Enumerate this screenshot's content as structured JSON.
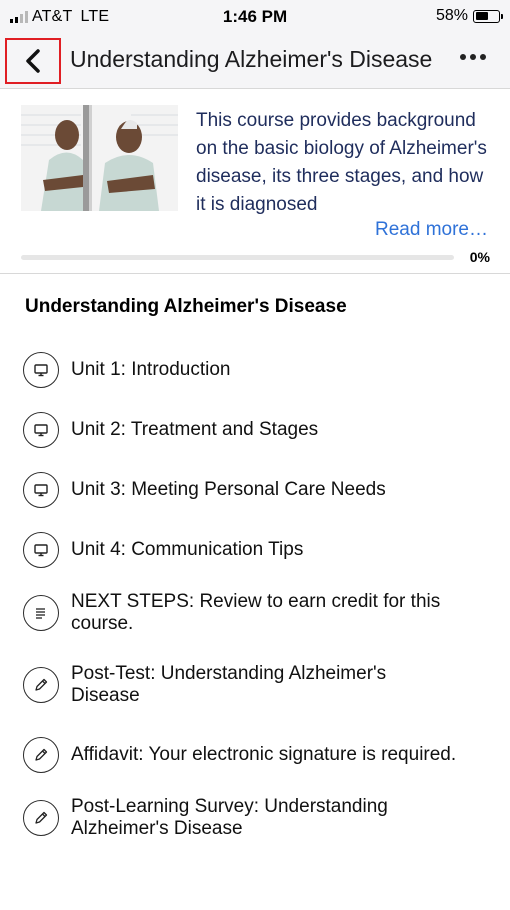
{
  "status_bar": {
    "carrier": "AT&T",
    "network": "LTE",
    "time": "1:46 PM",
    "battery": "58%",
    "battery_level": 0.58
  },
  "nav": {
    "title": "Understanding Alzheimer's Disease",
    "back_icon": "chevron-left-icon",
    "more_icon": "more-horizontal-icon"
  },
  "course": {
    "description": "This course provides background on the basic biology of Alzheimer's disease, its three stages, and how it is diagnosed",
    "read_more": "Read more…",
    "progress_label": "0%",
    "progress_value": 0
  },
  "section": {
    "title": "Understanding Alzheimer's Disease",
    "items": [
      {
        "label": "Unit 1: Introduction",
        "icon": "presentation-icon"
      },
      {
        "label": "Unit 2: Treatment and Stages",
        "icon": "presentation-icon"
      },
      {
        "label": "Unit 3: Meeting Personal Care Needs",
        "icon": "presentation-icon"
      },
      {
        "label": "Unit 4: Communication Tips",
        "icon": "presentation-icon"
      },
      {
        "label": "NEXT STEPS: Review to earn credit for this course.",
        "icon": "document-icon"
      },
      {
        "label": "Post-Test: Understanding Alzheimer's Disease",
        "icon": "pencil-icon"
      },
      {
        "label": "Affidavit: Your electronic signature is required.",
        "icon": "pencil-icon"
      },
      {
        "label": "Post-Learning Survey: Understanding Alzheimer's Disease",
        "icon": "pencil-icon"
      }
    ]
  },
  "colors": {
    "accent": "#2f72d8",
    "description_text": "#1f2d5c",
    "highlight_border": "#e01e24"
  }
}
